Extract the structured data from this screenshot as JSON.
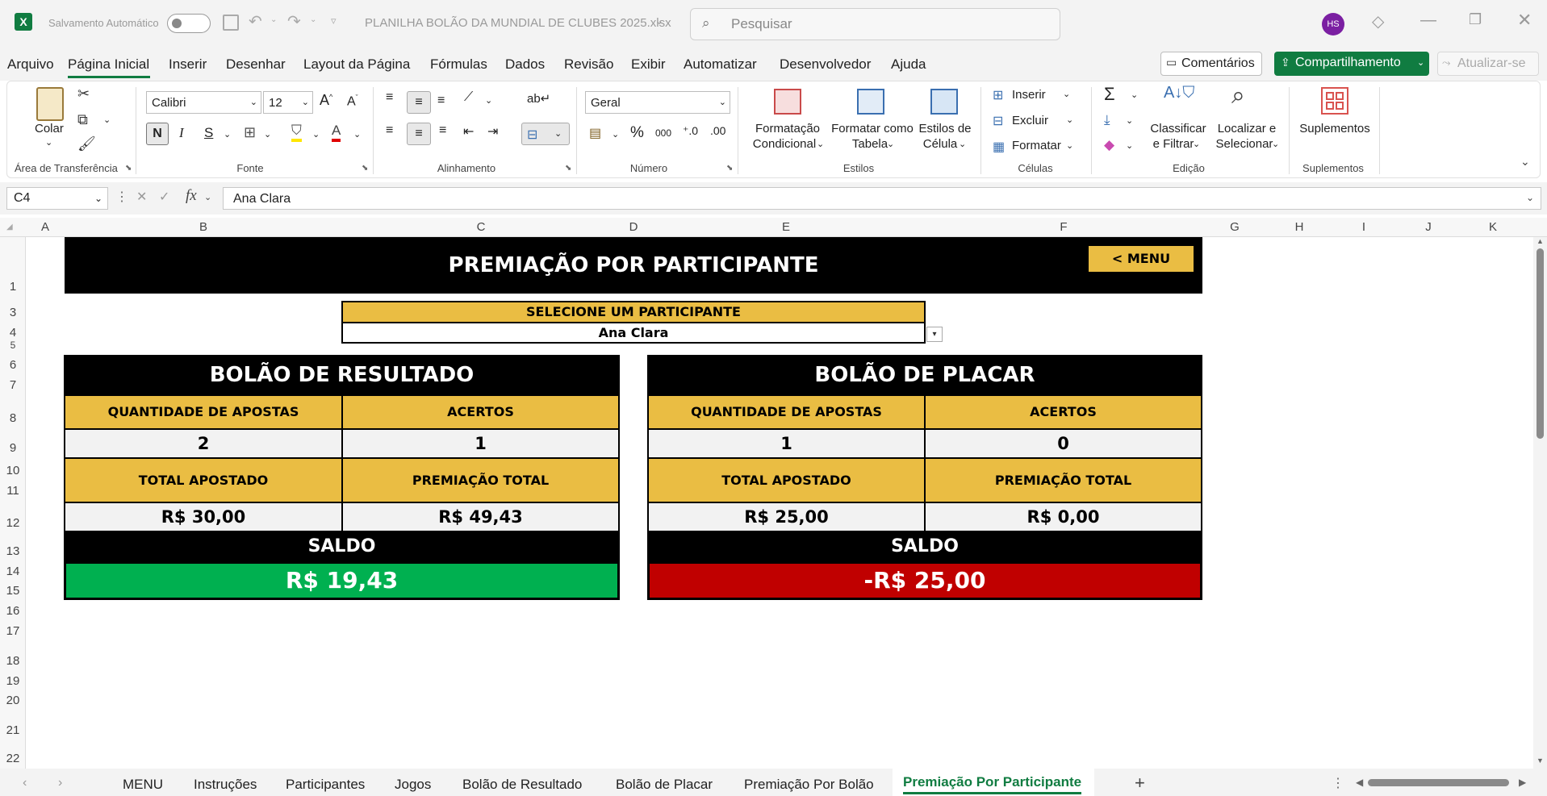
{
  "titlebar": {
    "autosave_label": "Salvamento Automático",
    "filename": "PLANILHA BOLÃO DA MUNDIAL DE CLUBES 2025.xlsx",
    "search_placeholder": "Pesquisar",
    "avatar": "HS"
  },
  "menu": [
    "Arquivo",
    "Página Inicial",
    "Inserir",
    "Desenhar",
    "Layout da Página",
    "Fórmulas",
    "Dados",
    "Revisão",
    "Exibir",
    "Automatizar",
    "Desenvolvedor",
    "Ajuda"
  ],
  "menu_right": {
    "comments": "Comentários",
    "share": "Compartilhamento",
    "update": "Atualizar-se"
  },
  "ribbon": {
    "clipboard": {
      "paste": "Colar",
      "label": "Área de Transferência"
    },
    "font": {
      "family": "Calibri",
      "size": "12",
      "bold": "N",
      "italic": "I",
      "underline": "S",
      "label": "Fonte"
    },
    "alignment": {
      "label": "Alinhamento"
    },
    "number": {
      "format": "Geral",
      "label": "Número"
    },
    "styles": {
      "conditional_1": "Formatação",
      "conditional_2": "Condicional",
      "table_1": "Formatar como",
      "table_2": "Tabela",
      "cell_1": "Estilos de",
      "cell_2": "Célula",
      "label": "Estilos"
    },
    "cells": {
      "insert": "Inserir",
      "delete": "Excluir",
      "format": "Formatar",
      "label": "Células"
    },
    "editing": {
      "sort_1": "Classificar",
      "sort_2": "e Filtrar",
      "find_1": "Localizar e",
      "find_2": "Selecionar",
      "label": "Edição"
    },
    "addins": {
      "button": "Suplementos",
      "label": "Suplementos"
    }
  },
  "formula_bar": {
    "name_box": "C4",
    "fx": "fx",
    "content": "Ana Clara"
  },
  "columns": [
    "A",
    "B",
    "C",
    "D",
    "E",
    "F",
    "G",
    "H",
    "I",
    "J",
    "K"
  ],
  "rows": [
    "1",
    "3",
    "4",
    "5",
    "6",
    "7",
    "8",
    "9",
    "10",
    "11",
    "12",
    "13",
    "14",
    "15",
    "16",
    "17",
    "18",
    "19",
    "20",
    "21",
    "22"
  ],
  "sheet": {
    "title": "PREMIAÇÃO POR PARTICIPANTE",
    "menu_button": "< MENU",
    "select_label": "SELECIONE UM PARTICIPANTE",
    "participant": "Ana Clara",
    "resultado": {
      "title": "BOLÃO DE RESULTADO",
      "h_qtd": "QUANTIDADE DE APOSTAS",
      "h_acertos": "ACERTOS",
      "qtd": "2",
      "acertos": "1",
      "h_total": "TOTAL APOSTADO",
      "h_premio": "PREMIAÇÃO TOTAL",
      "total": "R$ 30,00",
      "premio": "R$ 49,43",
      "saldo_label": "SALDO",
      "saldo": "R$ 19,43",
      "saldo_color": "#00b050"
    },
    "placar": {
      "title": "BOLÃO DE PLACAR",
      "h_qtd": "QUANTIDADE DE APOSTAS",
      "h_acertos": "ACERTOS",
      "qtd": "1",
      "acertos": "0",
      "h_total": "TOTAL APOSTADO",
      "h_premio": "PREMIAÇÃO TOTAL",
      "total": "R$ 25,00",
      "premio": "R$ 0,00",
      "saldo_label": "SALDO",
      "saldo": "-R$ 25,00",
      "saldo_color": "#c00000"
    }
  },
  "tabs": [
    "MENU",
    "Instruções",
    "Participantes",
    "Jogos",
    "Bolão de Resultado",
    "Bolão de Placar",
    "Premiação Por Bolão",
    "Premiação Por Participante"
  ],
  "active_tab": "Premiação Por Participante"
}
